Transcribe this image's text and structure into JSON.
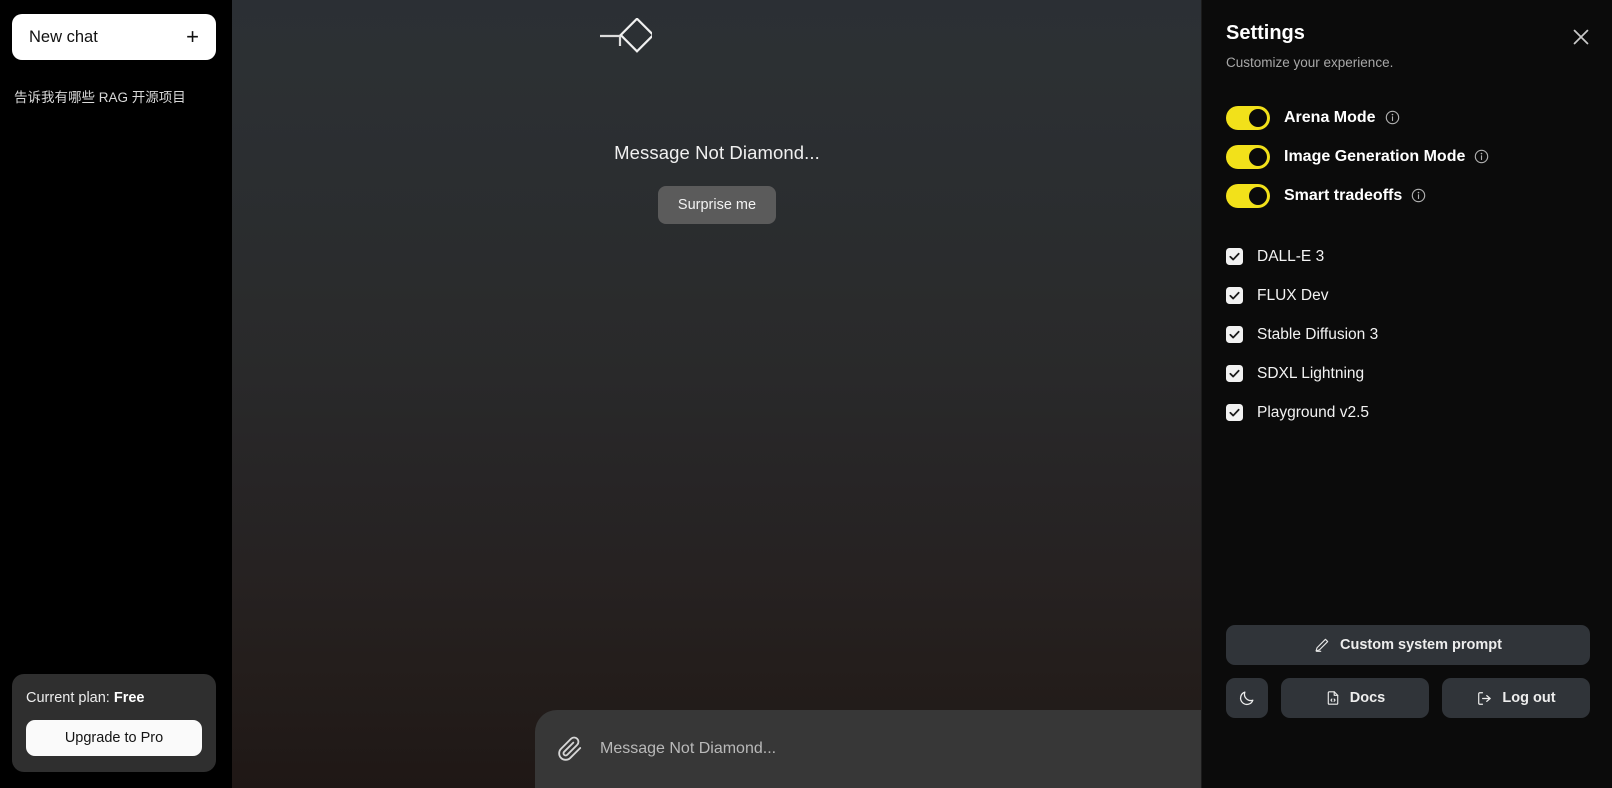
{
  "sidebar": {
    "new_chat_label": "New chat",
    "new_chat_icon": "plus-icon",
    "history": [
      {
        "label": "告诉我有哪些 RAG 开源项目"
      }
    ],
    "plan": {
      "prefix": "Current plan:",
      "value": "Free",
      "upgrade_label": "Upgrade to Pro"
    }
  },
  "main": {
    "brand_icon": "diamond-logo",
    "empty_title": "Message Not Diamond...",
    "surprise_label": "Surprise me",
    "composer": {
      "attach_icon": "paperclip-icon",
      "placeholder": "Message Not Diamond...",
      "value": ""
    }
  },
  "settings": {
    "title": "Settings",
    "subtitle": "Customize your experience.",
    "close_icon": "close-icon",
    "info_icon": "info-icon",
    "toggles": [
      {
        "label": "Arena Mode",
        "on": true
      },
      {
        "label": "Image Generation Mode",
        "on": true
      },
      {
        "label": "Smart tradeoffs",
        "on": true
      }
    ],
    "models": [
      {
        "label": "DALL-E 3",
        "checked": true
      },
      {
        "label": "FLUX Dev",
        "checked": true
      },
      {
        "label": "Stable Diffusion 3",
        "checked": true
      },
      {
        "label": "SDXL Lightning",
        "checked": true
      },
      {
        "label": "Playground v2.5",
        "checked": true
      }
    ],
    "footer": {
      "custom_prompt_label": "Custom system prompt",
      "custom_prompt_icon": "pencil-icon",
      "theme_icon": "moon-icon",
      "docs_label": "Docs",
      "docs_icon": "file-code-icon",
      "logout_label": "Log out",
      "logout_icon": "logout-icon"
    }
  },
  "colors": {
    "accent_yellow": "#F2E11A",
    "panel_bg": "#0B0B0B",
    "button_bg": "#303439",
    "sidebar_bg": "#000000"
  }
}
